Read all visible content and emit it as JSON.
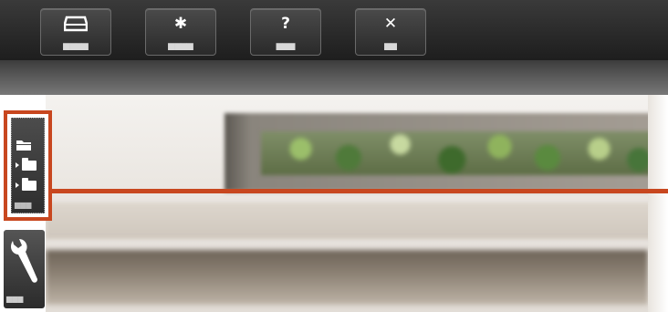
{
  "toolbar": {
    "buttons": [
      {
        "icon": "tray-icon",
        "label": "▆▆▆▆"
      },
      {
        "icon": "gear-icon",
        "glyph": "✱",
        "label": "▆▆▆▆"
      },
      {
        "icon": "help-icon",
        "glyph": "?",
        "label": "▆▆▆"
      },
      {
        "icon": "close-icon",
        "glyph": "✕",
        "label": "▆▆"
      }
    ]
  },
  "sidebar": {
    "folders_label": "▆▆▆",
    "tools_label": "▆▆▆"
  },
  "colors": {
    "highlight": "#c8471f",
    "toolbar_bg": "#262626"
  }
}
